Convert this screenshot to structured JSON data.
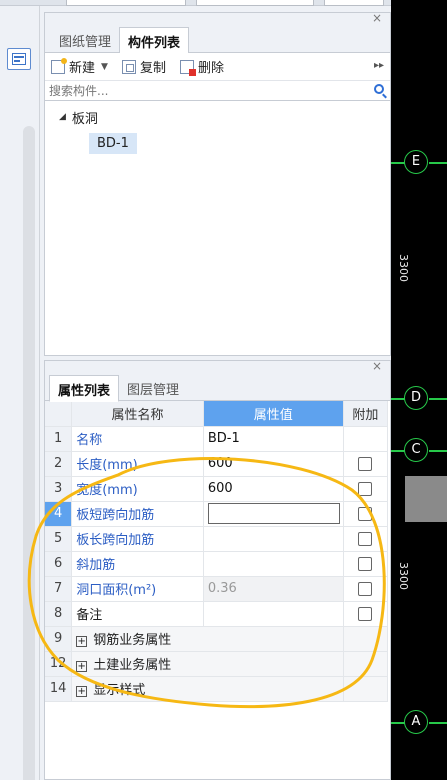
{
  "drawing_panel": {
    "tabs": [
      "图纸管理",
      "构件列表"
    ],
    "active_tab": 1,
    "toolbar": {
      "new_label": "新建",
      "copy_label": "复制",
      "delete_label": "删除"
    },
    "search_placeholder": "搜索构件...",
    "tree": {
      "group_label": "板洞",
      "items": [
        "BD-1"
      ]
    }
  },
  "properties_panel": {
    "tabs": [
      "属性列表",
      "图层管理"
    ],
    "active_tab": 0,
    "columns": {
      "name": "属性名称",
      "value": "属性值",
      "extra": "附加"
    },
    "rows": [
      {
        "num": "1",
        "name": "名称",
        "value": "BD-1"
      },
      {
        "num": "2",
        "name": "长度(mm)",
        "value": "600"
      },
      {
        "num": "3",
        "name": "宽度(mm)",
        "value": "600"
      },
      {
        "num": "4",
        "name": "板短跨向加筋",
        "value": ""
      },
      {
        "num": "5",
        "name": "板长跨向加筋",
        "value": ""
      },
      {
        "num": "6",
        "name": "斜加筋",
        "value": ""
      },
      {
        "num": "7",
        "name": "洞口面积(m²)",
        "value": "0.36"
      },
      {
        "num": "8",
        "name": "备注",
        "value": ""
      }
    ],
    "groups": [
      {
        "num": "9",
        "label": "钢筋业务属性"
      },
      {
        "num": "12",
        "label": "土建业务属性"
      },
      {
        "num": "14",
        "label": "显示样式"
      }
    ]
  },
  "canvas": {
    "axes": [
      "E",
      "D",
      "C",
      "A"
    ],
    "dimensions": [
      "3300",
      "3300"
    ],
    "axis_color": "#27c94a"
  },
  "colors": {
    "accent": "#5ea2ee",
    "link_text": "#2c5ec4",
    "annotation": "#f6b814"
  }
}
